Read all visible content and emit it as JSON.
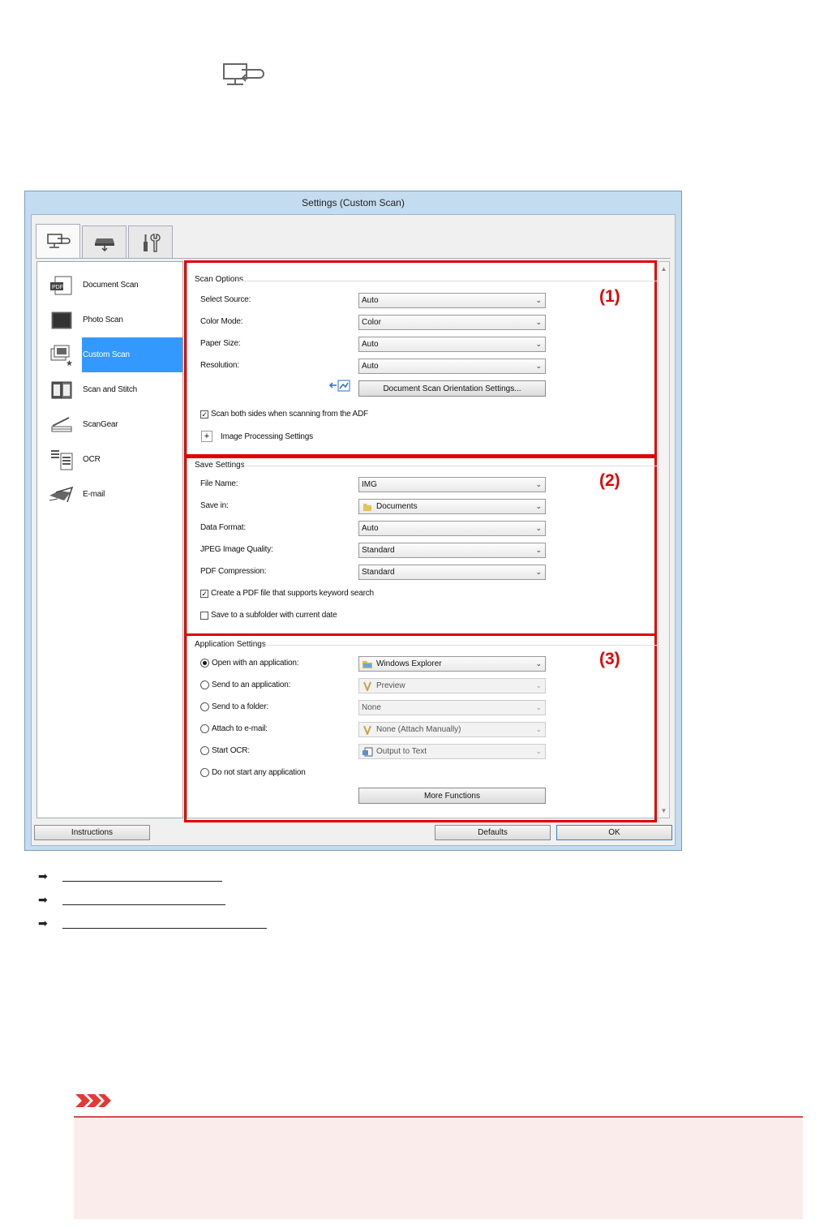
{
  "window": {
    "title": "Settings (Custom Scan)",
    "tabs": [
      {
        "name": "scan-from-computer-tab",
        "icon": "computer-scan-icon",
        "active": true
      },
      {
        "name": "scan-from-panel-tab",
        "icon": "scanner-panel-icon",
        "active": false
      },
      {
        "name": "general-settings-tab",
        "icon": "tools-icon",
        "active": false
      }
    ]
  },
  "nav": {
    "items": [
      {
        "label": "Document Scan",
        "icon": "pdf-document-icon"
      },
      {
        "label": "Photo Scan",
        "icon": "photo-icon"
      },
      {
        "label": "Custom Scan",
        "icon": "custom-scan-icon",
        "selected": true
      },
      {
        "label": "Scan and Stitch",
        "icon": "stitch-icon"
      },
      {
        "label": "ScanGear",
        "icon": "scangear-icon"
      },
      {
        "label": "OCR",
        "icon": "ocr-icon"
      },
      {
        "label": "E-mail",
        "icon": "email-icon"
      }
    ]
  },
  "scan_options": {
    "heading": "Scan Options",
    "number": "(1)",
    "select_source": {
      "label": "Select Source:",
      "value": "Auto"
    },
    "color_mode": {
      "label": "Color Mode:",
      "value": "Color"
    },
    "paper_size": {
      "label": "Paper Size:",
      "value": "Auto"
    },
    "resolution": {
      "label": "Resolution:",
      "value": "Auto"
    },
    "orientation_button": "Document Scan Orientation Settings...",
    "scan_both_sides": {
      "label": "Scan both sides when scanning from the ADF",
      "checked": true
    },
    "image_processing": "Image Processing Settings"
  },
  "save_settings": {
    "heading": "Save Settings",
    "number": "(2)",
    "file_name": {
      "label": "File Name:",
      "value": "IMG"
    },
    "save_in": {
      "label": "Save in:",
      "value": "Documents"
    },
    "data_format": {
      "label": "Data Format:",
      "value": "Auto"
    },
    "jpeg_quality": {
      "label": "JPEG Image Quality:",
      "value": "Standard"
    },
    "pdf_compression": {
      "label": "PDF Compression:",
      "value": "Standard"
    },
    "keyword_pdf": {
      "label": "Create a PDF file that supports keyword search",
      "checked": true
    },
    "subfolder": {
      "label": "Save to a subfolder with current date",
      "checked": false
    }
  },
  "application_settings": {
    "heading": "Application Settings",
    "number": "(3)",
    "open_with": {
      "label": "Open with an application:",
      "value": "Windows Explorer",
      "selected": true
    },
    "send_to_app": {
      "label": "Send to an application:",
      "value": "Preview"
    },
    "send_to_folder": {
      "label": "Send to a folder:",
      "value": "None"
    },
    "attach_email": {
      "label": "Attach to e-mail:",
      "value": "None (Attach Manually)"
    },
    "start_ocr": {
      "label": "Start OCR:",
      "value": "Output to Text"
    },
    "no_app": {
      "label": "Do not start any application"
    },
    "more_functions": "More Functions"
  },
  "footer": {
    "instructions": "Instructions",
    "defaults": "Defaults",
    "ok": "OK"
  },
  "colors": {
    "highlight": "#3399ff",
    "annotation_red": "#e00000",
    "window_frame": "#c4dcef",
    "important_bg": "#fbecec"
  }
}
